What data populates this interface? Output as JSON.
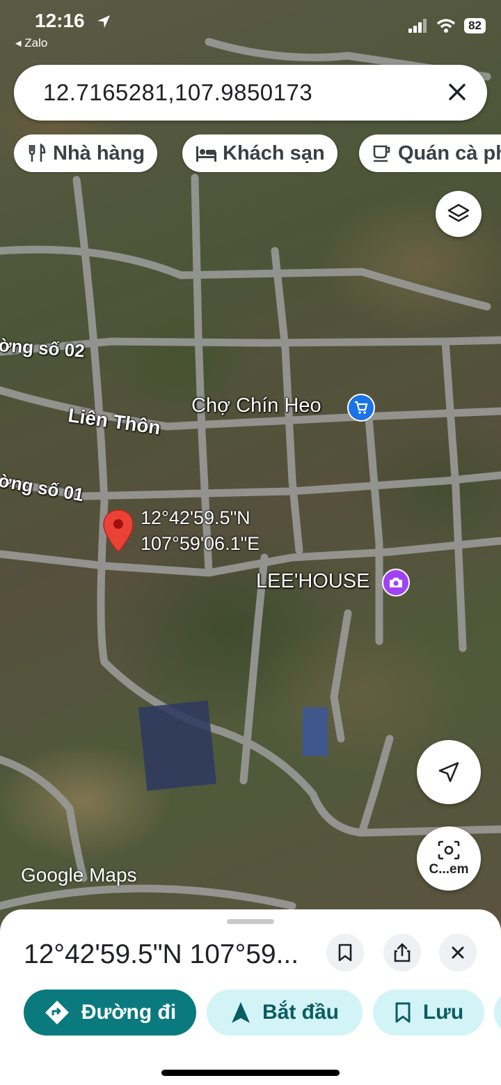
{
  "status_bar": {
    "time": "12:16",
    "back_app": "◂ Zalo",
    "battery": "82"
  },
  "search": {
    "query": "12.7165281,107.9850173"
  },
  "chips": [
    {
      "label": "Nhà hàng",
      "icon": "restaurant-icon"
    },
    {
      "label": "Khách sạn",
      "icon": "hotel-icon"
    },
    {
      "label": "Quán cà phê",
      "icon": "cafe-icon"
    }
  ],
  "map": {
    "street_labels": [
      "ờng số 02",
      "Liên Thôn",
      "ờng số 01"
    ],
    "pois": [
      {
        "name": "Chợ Chín Heo",
        "icon": "shopping-cart-icon",
        "color": "#1a73e8"
      },
      {
        "name": "LEE'HOUSE",
        "icon": "camera-icon",
        "color": "#a142f4"
      }
    ],
    "pin": {
      "lat": "12°42'59.5\"N",
      "lng": "107°59'06.1\"E",
      "color": "#ea4335"
    },
    "logo": "Google Maps",
    "lens_label": "C...em"
  },
  "sheet": {
    "title": "12°42'59.5\"N 107°59...",
    "actions": [
      {
        "label": "Đường đi",
        "icon": "directions-icon",
        "bg": "#0b7a7f",
        "fg": "#ffffff"
      },
      {
        "label": "Bắt đầu",
        "icon": "navigation-icon",
        "bg": "#d3f4f7",
        "fg": "#0b5c61"
      },
      {
        "label": "Lưu",
        "icon": "bookmark-icon",
        "bg": "#d3f4f7",
        "fg": "#0b5c61"
      }
    ]
  }
}
